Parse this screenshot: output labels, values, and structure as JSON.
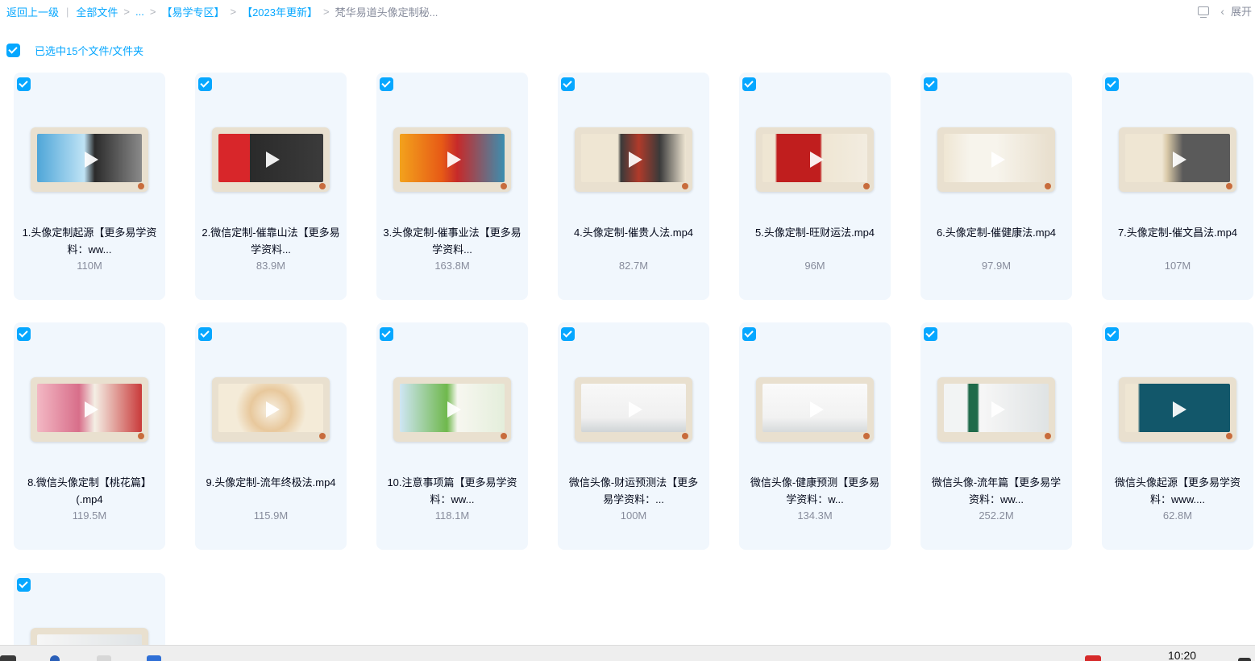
{
  "breadcrumb": {
    "back": "返回上一级",
    "all_files": "全部文件",
    "ellipsis": "...",
    "folder1": "【易学专区】",
    "folder2": "【2023年更新】",
    "current": "梵华易道头像定制秘..."
  },
  "toolbar": {
    "expand_label": "展开"
  },
  "selection": {
    "label": "已选中15个文件/文件夹",
    "checked": true
  },
  "files": [
    {
      "name": "1.头像定制起源【更多易学资料：ww...",
      "size": "110M"
    },
    {
      "name": "2.微信定制-催靠山法【更多易学资料...",
      "size": "83.9M"
    },
    {
      "name": "3.头像定制-催事业法【更多易学资料...",
      "size": "163.8M"
    },
    {
      "name": "4.头像定制-催贵人法.mp4",
      "size": "82.7M"
    },
    {
      "name": "5.头像定制-旺财运法.mp4",
      "size": "96M"
    },
    {
      "name": "6.头像定制-催健康法.mp4",
      "size": "97.9M"
    },
    {
      "name": "7.头像定制-催文昌法.mp4",
      "size": "107M"
    },
    {
      "name": "8.微信头像定制【桃花篇】(.mp4",
      "size": "119.5M"
    },
    {
      "name": "9.头像定制-流年终极法.mp4",
      "size": "115.9M"
    },
    {
      "name": "10.注意事项篇【更多易学资料：ww...",
      "size": "118.1M"
    },
    {
      "name": "微信头像-财运预测法【更多易学资料：...",
      "size": "100M"
    },
    {
      "name": "微信头像-健康预测【更多易学资料：w...",
      "size": "134.3M"
    },
    {
      "name": "微信头像-流年篇【更多易学资料：ww...",
      "size": "252.2M"
    },
    {
      "name": "微信头像起源【更多易学资料：www....",
      "size": "62.8M"
    },
    {
      "name": "",
      "size": ""
    }
  ],
  "taskbar": {
    "clock": "10:20"
  },
  "colors": {
    "accent": "#06a7ff",
    "card_bg": "#f1f7fd",
    "muted": "#878c9c"
  }
}
